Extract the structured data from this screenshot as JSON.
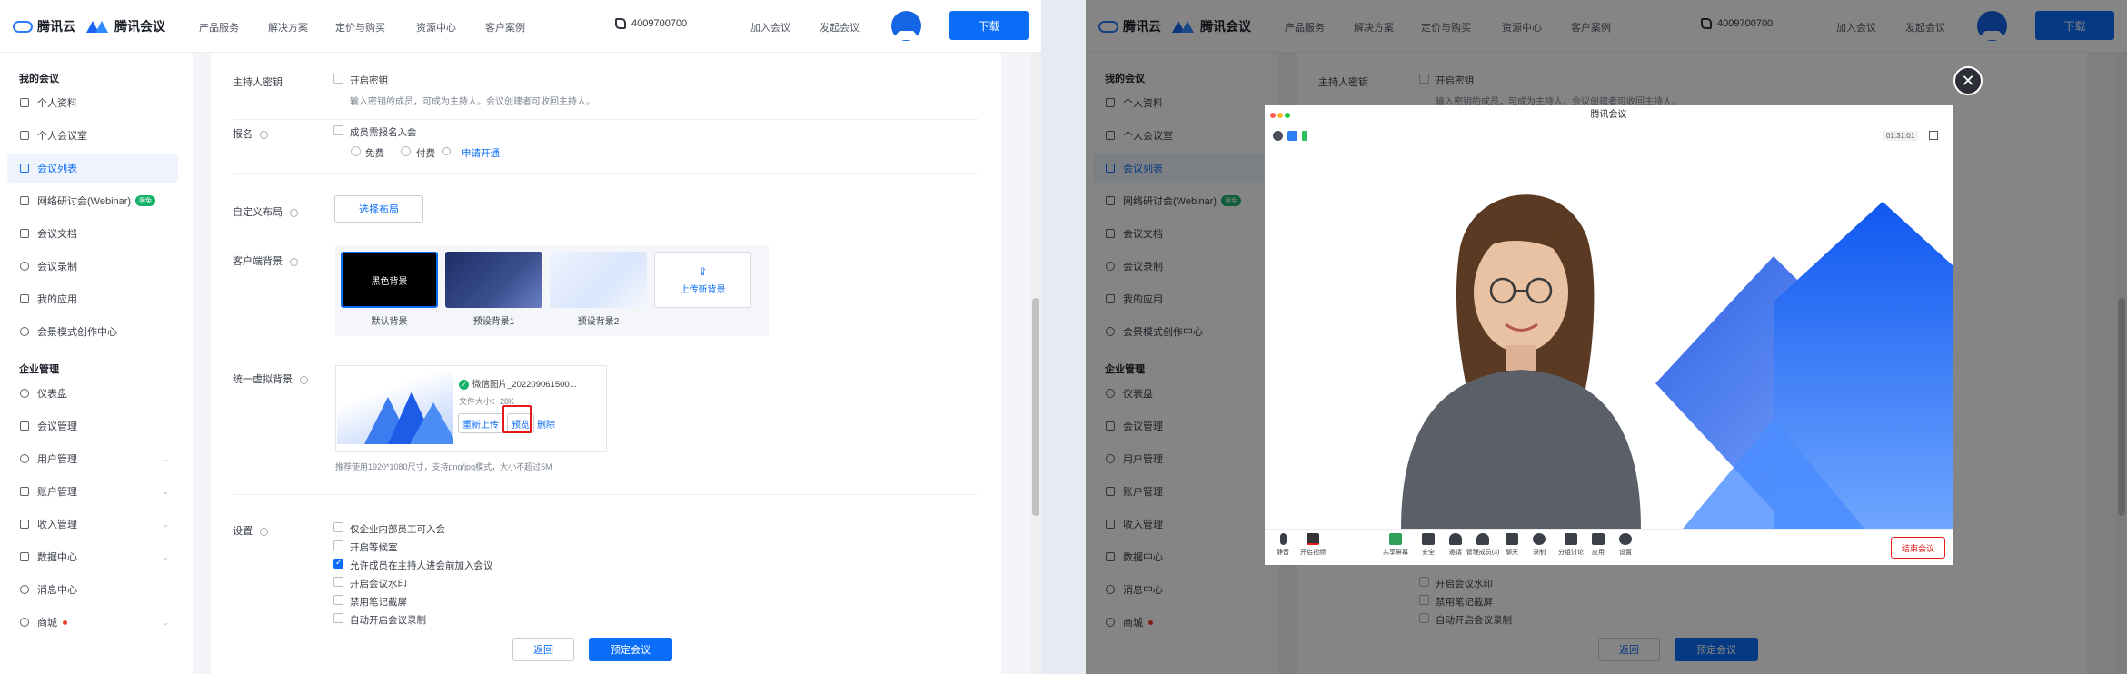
{
  "header": {
    "brand_cloud": "腾讯云",
    "brand_meeting": "腾讯会议",
    "nav": [
      "产品服务",
      "解决方案",
      "定价与购买",
      "资源中心",
      "客户案例"
    ],
    "phone": "4009700700",
    "join": "加入会议",
    "start": "发起会议",
    "download": "下载"
  },
  "sidebar": {
    "group1": "我的会议",
    "items1": [
      {
        "label": "个人资料",
        "icon": "user-icon"
      },
      {
        "label": "个人会议室",
        "icon": "room-icon"
      },
      {
        "label": "会议列表",
        "icon": "list-icon"
      },
      {
        "label": "网络研讨会(Webinar)",
        "icon": "webinar-icon",
        "badge": "限免"
      },
      {
        "label": "会议文档",
        "icon": "doc-icon"
      },
      {
        "label": "会议录制",
        "icon": "record-icon"
      },
      {
        "label": "我的应用",
        "icon": "apps-icon"
      },
      {
        "label": "会景模式创作中心",
        "icon": "scene-icon"
      }
    ],
    "group2": "企业管理",
    "items2": [
      {
        "label": "仪表盘",
        "icon": "dashboard-icon"
      },
      {
        "label": "会议管理",
        "icon": "grid-icon"
      },
      {
        "label": "用户管理",
        "icon": "users-icon"
      },
      {
        "label": "账户管理",
        "icon": "account-icon"
      },
      {
        "label": "收入管理",
        "icon": "income-icon"
      },
      {
        "label": "数据中心",
        "icon": "data-icon"
      },
      {
        "label": "消息中心",
        "icon": "message-icon"
      },
      {
        "label": "商城",
        "icon": "store-icon"
      }
    ]
  },
  "form": {
    "host_key_label": "主持人密钥",
    "host_key_option": "开启密钥",
    "host_key_desc": "输入密钥的成员，可成为主持人。会议创建者可收回主持人。",
    "signup_label": "报名",
    "signup_option": "成员需报名入会",
    "signup_free": "免费",
    "signup_paid": "付费",
    "signup_apply": "申请开通",
    "layout_label": "自定义布局",
    "layout_btn": "选择布局",
    "client_bg_label": "客户端背景",
    "bg_black_text": "黑色背景",
    "bg_captions": [
      "默认背景",
      "预设背景1",
      "预设背景2"
    ],
    "upload_bg": "上传新背景",
    "vbg_label": "统一虚拟背景",
    "vbg_filename": "微信图片_202209061500...",
    "vbg_size": "文件大小：28K",
    "vbg_reupload": "重新上传",
    "vbg_preview": "预览",
    "vbg_delete": "删除",
    "vbg_hint": "推荐使用1920*1080尺寸，支持png/jpg模式，大小不超过5M",
    "settings_label": "设置",
    "settings": [
      {
        "label": "仅企业内部员工可入会",
        "checked": false
      },
      {
        "label": "开启等候室",
        "checked": false
      },
      {
        "label": "允许成员在主持人进会前加入会议",
        "checked": true
      },
      {
        "label": "开启会议水印",
        "checked": false
      },
      {
        "label": "禁用笔记截屏",
        "checked": false
      },
      {
        "label": "自动开启会议录制",
        "checked": false
      }
    ],
    "back_btn": "返回",
    "submit_btn": "预定会议"
  },
  "meeting": {
    "title": "腾讯会议",
    "timer": "01:31:01",
    "toolbar": [
      "静音",
      "开启视频",
      "共享屏幕",
      "安全",
      "邀请",
      "管理成员(3)",
      "聊天",
      "录制",
      "分组讨论",
      "应用",
      "设置"
    ],
    "end": "结束会议"
  },
  "colors": {
    "accent": "#0a6df7",
    "danger": "#e31a1a",
    "success": "#17b26a"
  }
}
